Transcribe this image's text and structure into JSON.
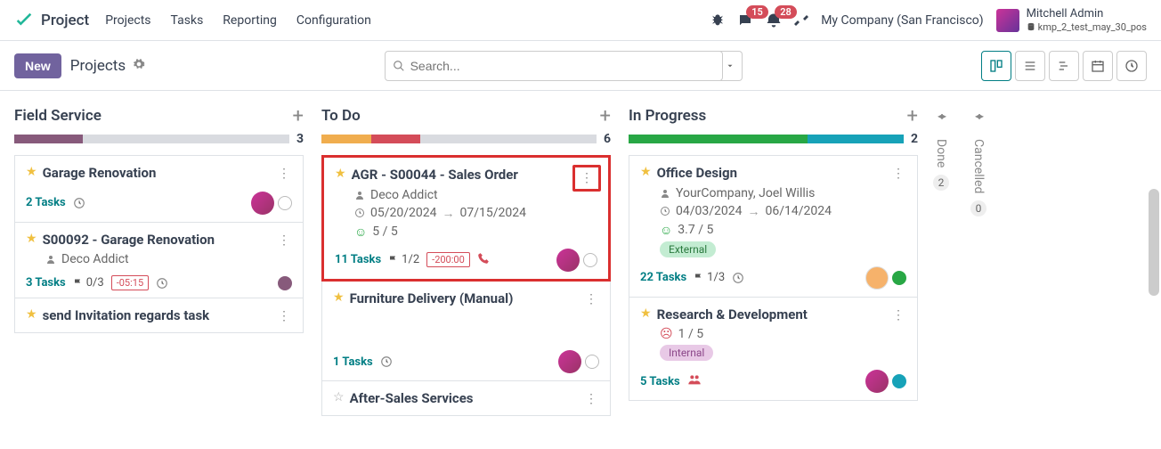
{
  "app": {
    "name": "Project"
  },
  "nav": {
    "items": [
      "Projects",
      "Tasks",
      "Reporting",
      "Configuration"
    ]
  },
  "systray": {
    "messages_badge": "15",
    "activities_badge": "28",
    "company": "My Company (San Francisco)",
    "user_name": "Mitchell Admin",
    "user_db": "kmp_2_test_may_30_pos"
  },
  "controls": {
    "new_label": "New",
    "breadcrumb": "Projects",
    "search_placeholder": "Search..."
  },
  "columns": [
    {
      "title": "Field Service",
      "count": "3",
      "bar": [
        {
          "color": "#875a7b",
          "w": 25
        }
      ],
      "cards": [
        {
          "title": "Garage Renovation",
          "star": true,
          "tasks": "2 Tasks",
          "foot_icons": [
            "clock"
          ],
          "dot": "none",
          "avatar": true
        },
        {
          "title": "S00092 - Garage Renovation",
          "star": true,
          "partner": "Deco Addict",
          "tasks": "3 Tasks",
          "milestone": "0/3",
          "time_badge": "-05:15",
          "foot_icons": [
            "clock"
          ],
          "dot": "purple",
          "avatar": false
        },
        {
          "title": "send Invitation regards task",
          "star": true
        }
      ]
    },
    {
      "title": "To Do",
      "count": "6",
      "bar": [
        {
          "color": "#f0ad4e",
          "w": 18
        },
        {
          "color": "#d44c59",
          "w": 18
        }
      ],
      "cards": [
        {
          "title": "AGR - S00044 - Sales Order",
          "star": true,
          "highlight": true,
          "partner": "Deco Addict",
          "date_start": "05/20/2024",
          "date_end": "07/15/2024",
          "rating": "5 / 5",
          "rating_face": "green",
          "tasks": "11 Tasks",
          "milestone": "1/2",
          "time_badge": "-200:00",
          "phone": true,
          "avatar": true,
          "dot": "none"
        },
        {
          "title": "Furniture Delivery (Manual)",
          "star": true,
          "tasks": "1 Tasks",
          "foot_icons": [
            "clock"
          ],
          "avatar": true,
          "dot": "none"
        },
        {
          "title": "After-Sales Services",
          "star": false
        }
      ]
    },
    {
      "title": "In Progress",
      "count": "2",
      "bar": [
        {
          "color": "#28a745",
          "w": 65
        },
        {
          "color": "#17a2b8",
          "w": 35
        }
      ],
      "cards": [
        {
          "title": "Office Design",
          "star": true,
          "partner": "YourCompany, Joel Willis",
          "date_start": "04/03/2024",
          "date_end": "06/14/2024",
          "rating": "3.7 / 5",
          "rating_face": "green",
          "pill": "External",
          "pill_color": "green",
          "tasks": "22 Tasks",
          "milestone": "1/3",
          "foot_icons": [
            "clock"
          ],
          "avatar_alt": true,
          "dot": "green"
        },
        {
          "title": "Research & Development",
          "star": true,
          "rating": "1 / 5",
          "rating_face": "red",
          "pill": "Internal",
          "pill_color": "purple",
          "tasks": "5 Tasks",
          "people": true,
          "avatar": true,
          "dot": "blue"
        }
      ]
    }
  ],
  "folded": [
    {
      "label": "Done",
      "count": "2"
    },
    {
      "label": "Cancelled",
      "count": "0"
    }
  ]
}
